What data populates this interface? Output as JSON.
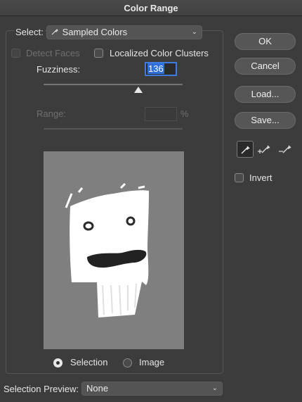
{
  "window": {
    "title": "Color Range"
  },
  "select": {
    "label": "Select:",
    "value": "Sampled Colors",
    "icon": "eyedropper-icon"
  },
  "options": {
    "detect_faces": {
      "label": "Detect Faces",
      "checked": false,
      "disabled": true
    },
    "localized_clusters": {
      "label": "Localized Color Clusters",
      "checked": false
    }
  },
  "fuzziness": {
    "label": "Fuzziness:",
    "value": "136"
  },
  "range": {
    "label": "Range:",
    "value": "",
    "unit": "%"
  },
  "buttons": {
    "ok": "OK",
    "cancel": "Cancel",
    "load": "Load...",
    "save": "Save..."
  },
  "tools": [
    "eyedropper-icon",
    "eyedropper-plus-icon",
    "eyedropper-minus-icon"
  ],
  "invert": {
    "label": "Invert",
    "checked": false
  },
  "preview_mode": {
    "selection_label": "Selection",
    "image_label": "Image",
    "selected": "Selection"
  },
  "selection_preview": {
    "label": "Selection Preview:",
    "value": "None"
  },
  "colors": {
    "accent": "#2f6fdc",
    "background": "#3c3c3c",
    "preview_bg": "#7f7f7f"
  }
}
